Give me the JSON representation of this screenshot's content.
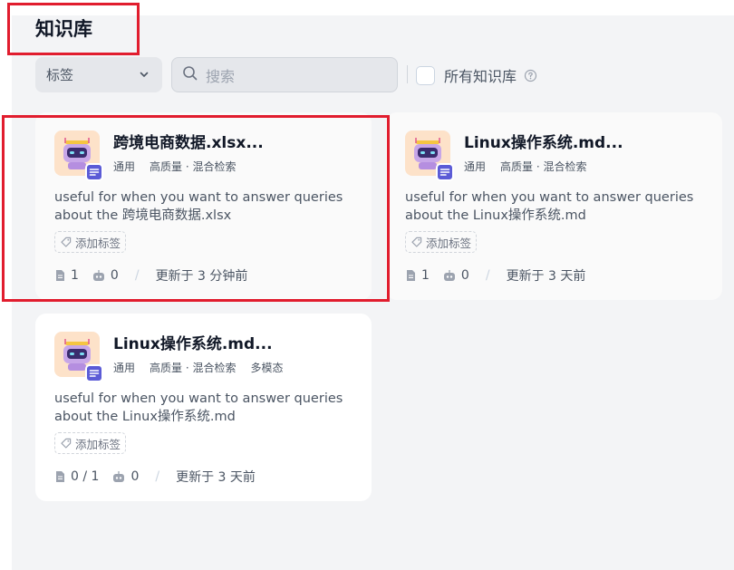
{
  "header": {
    "title": "知识库"
  },
  "filters": {
    "tag_select_label": "标签",
    "search_placeholder": "搜索",
    "all_kb_label": "所有知识库"
  },
  "cards": [
    {
      "name": "跨境电商数据.xlsx...",
      "meta": [
        "通用",
        "高质量 · 混合检索"
      ],
      "description": "useful for when you want to answer queries about the 跨境电商数据.xlsx",
      "add_tag": "添加标签",
      "docs": "1",
      "bots": "0",
      "updated": "更新于 3 分钟前"
    },
    {
      "name": "Linux操作系统.md...",
      "meta": [
        "通用",
        "高质量 · 混合检索"
      ],
      "description": "useful for when you want to answer queries about the Linux操作系统.md",
      "add_tag": "添加标签",
      "docs": "1",
      "bots": "0",
      "updated": "更新于 3 天前"
    },
    {
      "name": "Linux操作系统.md...",
      "meta": [
        "通用",
        "高质量 · 混合检索",
        "多模态"
      ],
      "description": "useful for when you want to answer queries about the Linux操作系统.md",
      "add_tag": "添加标签",
      "docs": "0 / 1",
      "bots": "0",
      "updated": "更新于 3 天前"
    }
  ],
  "colors": {
    "highlight": "#e11d2e",
    "badge": "#5b5bd6",
    "avatar_bg": "#fde2c9"
  }
}
